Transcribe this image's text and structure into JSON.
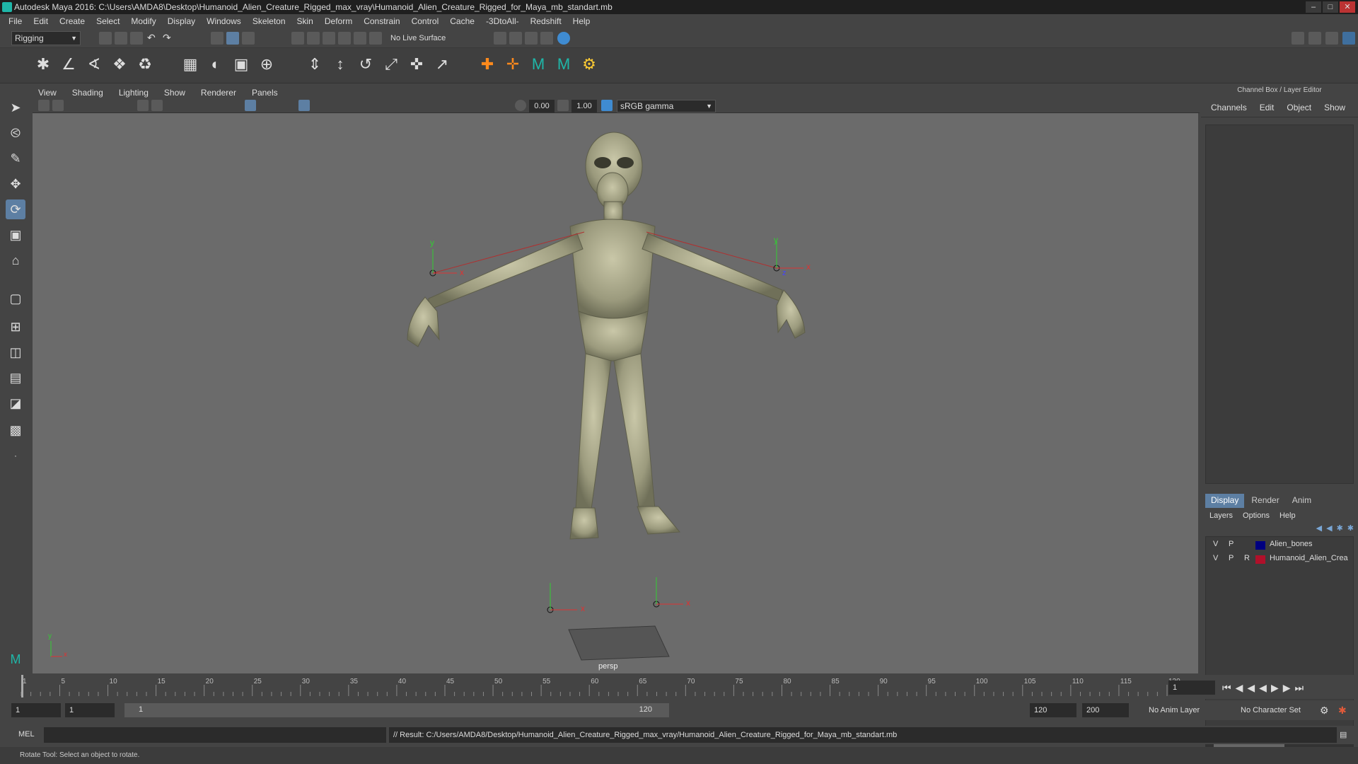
{
  "window": {
    "title": "Autodesk Maya 2016: C:\\Users\\AMDA8\\Desktop\\Humanoid_Alien_Creature_Rigged_max_vray\\Humanoid_Alien_Creature_Rigged_for_Maya_mb_standart.mb"
  },
  "menubar": [
    "File",
    "Edit",
    "Create",
    "Select",
    "Modify",
    "Display",
    "Windows",
    "Skeleton",
    "Skin",
    "Deform",
    "Constrain",
    "Control",
    "Cache",
    "-3DtoAll-",
    "Redshift",
    "Help"
  ],
  "statusline": {
    "menuset": "Rigging",
    "live_surface": "No Live Surface"
  },
  "viewport": {
    "menu": [
      "View",
      "Shading",
      "Lighting",
      "Show",
      "Renderer",
      "Panels"
    ],
    "exposure": "0.00",
    "gamma": "1.00",
    "color_space": "sRGB gamma",
    "camera_label": "persp",
    "axis_x": "x",
    "axis_y": "y",
    "axis_z": "z"
  },
  "channelbox": {
    "title": "Channel Box / Layer Editor",
    "menu": [
      "Channels",
      "Edit",
      "Object",
      "Show"
    ]
  },
  "layereditor": {
    "tabs": [
      "Display",
      "Render",
      "Anim"
    ],
    "menu": [
      "Layers",
      "Options",
      "Help"
    ],
    "layers": [
      {
        "v": "V",
        "p": "P",
        "r": "",
        "color": "#000080",
        "name": "Alien_bones"
      },
      {
        "v": "V",
        "p": "P",
        "r": "R",
        "color": "#b0102a",
        "name": "Humanoid_Alien_Crea"
      }
    ]
  },
  "timeline": {
    "ticks": [
      "1",
      "5",
      "10",
      "15",
      "20",
      "25",
      "30",
      "35",
      "40",
      "45",
      "50",
      "55",
      "60",
      "65",
      "70",
      "75",
      "80",
      "85",
      "90",
      "95",
      "100",
      "105",
      "110",
      "115",
      "120"
    ],
    "current_frame": "1"
  },
  "range": {
    "start": "1",
    "playback_start": "1",
    "slider_start": "1",
    "slider_end": "120",
    "playback_end": "120",
    "end": "200",
    "anim_layer": "No Anim Layer",
    "character_set": "No Character Set"
  },
  "cmdline": {
    "lang": "MEL",
    "result": "// Result: C:/Users/AMDA8/Desktop/Humanoid_Alien_Creature_Rigged_max_vray/Humanoid_Alien_Creature_Rigged_for_Maya_mb_standart.mb"
  },
  "helpline": "Rotate Tool: Select an object to rotate."
}
